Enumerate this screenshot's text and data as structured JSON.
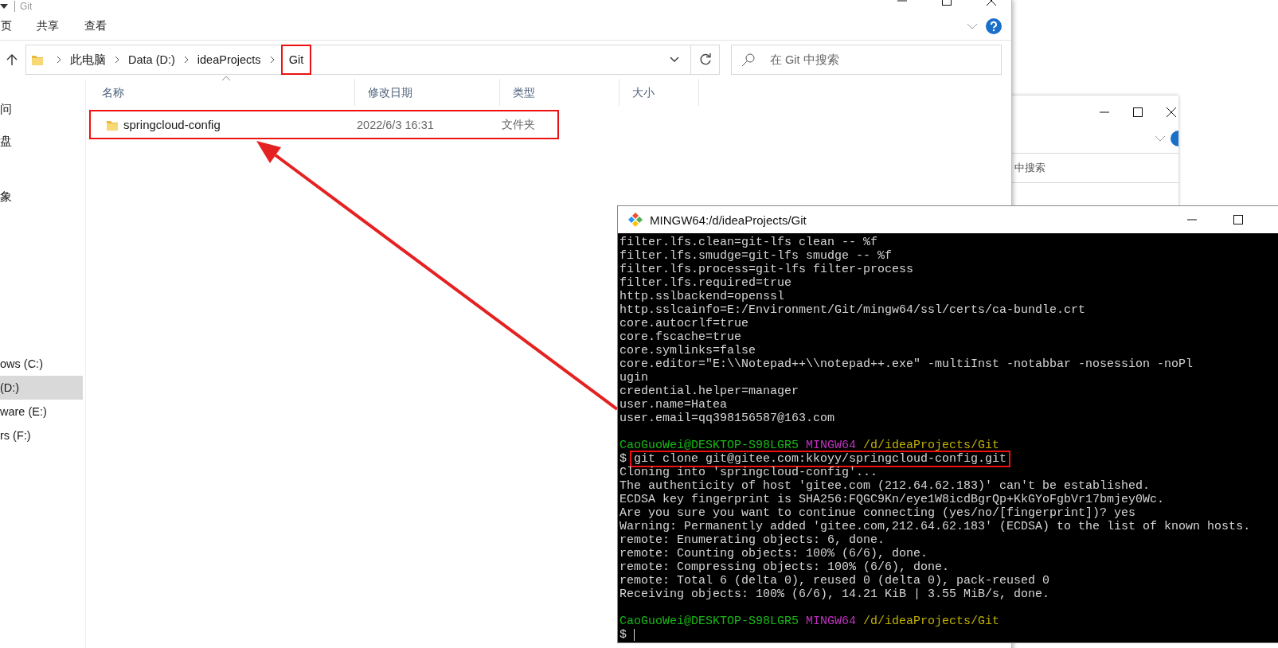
{
  "explorer": {
    "title": "Git",
    "ribbon_tabs": [
      "页",
      "共享",
      "查看"
    ],
    "breadcrumbs": [
      {
        "label": "此电脑",
        "highlighted": false
      },
      {
        "label": "Data (D:)",
        "highlighted": false
      },
      {
        "label": "ideaProjects",
        "highlighted": false
      },
      {
        "label": "Git",
        "highlighted": true
      }
    ],
    "search": {
      "placeholder": "在 Git 中搜索"
    },
    "nav_items": [
      {
        "label": "问",
        "selected": false
      },
      {
        "label": "盘",
        "selected": false
      },
      {
        "label": "象",
        "selected": false
      },
      {
        "label": "ows (C:)",
        "selected": false
      },
      {
        "label": "(D:)",
        "selected": true
      },
      {
        "label": "ware (E:)",
        "selected": false
      },
      {
        "label": "rs (F:)",
        "selected": false
      }
    ],
    "columns": [
      "名称",
      "修改日期",
      "类型",
      "大小"
    ],
    "rows": [
      {
        "name": "springcloud-config",
        "modified": "2022/6/3 16:31",
        "type": "文件夹",
        "highlighted": true
      }
    ]
  },
  "back_window": {
    "search_text": "中搜索"
  },
  "terminal": {
    "title": "MINGW64:/d/ideaProjects/Git",
    "lines": [
      {
        "kind": "output",
        "text": "filter.lfs.clean=git-lfs clean -- %f"
      },
      {
        "kind": "output",
        "text": "filter.lfs.smudge=git-lfs smudge -- %f"
      },
      {
        "kind": "output",
        "text": "filter.lfs.process=git-lfs filter-process"
      },
      {
        "kind": "output",
        "text": "filter.lfs.required=true"
      },
      {
        "kind": "output",
        "text": "http.sslbackend=openssl"
      },
      {
        "kind": "output",
        "text": "http.sslcainfo=E:/Environment/Git/mingw64/ssl/certs/ca-bundle.crt"
      },
      {
        "kind": "output",
        "text": "core.autocrlf=true"
      },
      {
        "kind": "output",
        "text": "core.fscache=true"
      },
      {
        "kind": "output",
        "text": "core.symlinks=false"
      },
      {
        "kind": "output",
        "text": "core.editor=\"E:\\\\Notepad++\\\\notepad++.exe\" -multiInst -notabbar -nosession -noPl"
      },
      {
        "kind": "output",
        "text": "ugin"
      },
      {
        "kind": "output",
        "text": "credential.helper=manager"
      },
      {
        "kind": "output",
        "text": "user.name=Hatea"
      },
      {
        "kind": "output",
        "text": "user.email=qq398156587@163.com"
      },
      {
        "kind": "blank"
      },
      {
        "kind": "prompt",
        "user": "CaoGuoWei@DESKTOP-S98LGR5",
        "shell": "MINGW64",
        "path": "/d/ideaProjects/Git"
      },
      {
        "kind": "command",
        "symbol": "$",
        "text": "git clone git@gitee.com:kkoyy/springcloud-config.git",
        "highlighted": true
      },
      {
        "kind": "output",
        "text": "Cloning into 'springcloud-config'..."
      },
      {
        "kind": "output",
        "text": "The authenticity of host 'gitee.com (212.64.62.183)' can't be established."
      },
      {
        "kind": "output",
        "text": "ECDSA key fingerprint is SHA256:FQGC9Kn/eye1W8icdBgrQp+KkGYoFgbVr17bmjey0Wc."
      },
      {
        "kind": "output",
        "text": "Are you sure you want to continue connecting (yes/no/[fingerprint])? yes"
      },
      {
        "kind": "output",
        "text": "Warning: Permanently added 'gitee.com,212.64.62.183' (ECDSA) to the list of known hosts."
      },
      {
        "kind": "output",
        "text": "remote: Enumerating objects: 6, done."
      },
      {
        "kind": "output",
        "text": "remote: Counting objects: 100% (6/6), done."
      },
      {
        "kind": "output",
        "text": "remote: Compressing objects: 100% (6/6), done."
      },
      {
        "kind": "output",
        "text": "remote: Total 6 (delta 0), reused 0 (delta 0), pack-reused 0"
      },
      {
        "kind": "output",
        "text": "Receiving objects: 100% (6/6), 14.21 KiB | 3.55 MiB/s, done."
      },
      {
        "kind": "blank"
      },
      {
        "kind": "prompt",
        "user": "CaoGuoWei@DESKTOP-S98LGR5",
        "shell": "MINGW64",
        "path": "/d/ideaProjects/Git"
      },
      {
        "kind": "input",
        "symbol": "$"
      }
    ]
  }
}
